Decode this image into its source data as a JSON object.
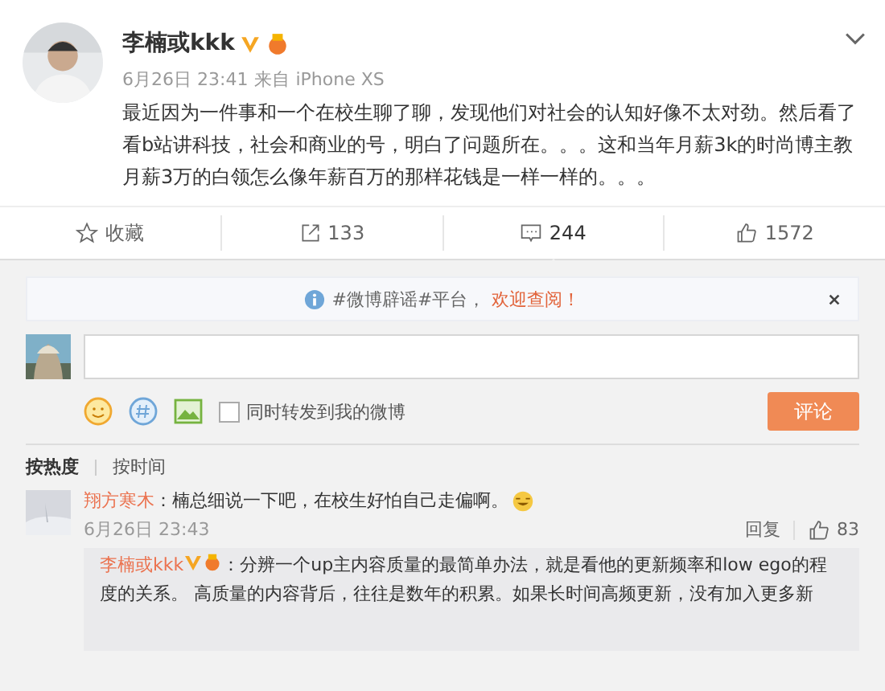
{
  "post": {
    "author": "李楠或kkk",
    "verified": true,
    "time": "6月26日 23:41",
    "source": "来自 iPhone XS",
    "body": "最近因为一件事和一个在校生聊了聊，发现他们对社会的认知好像不太对劲。然后看了看b站讲科技，社会和商业的号，明白了问题所在。。。这和当年月薪3k的时尚博主教月薪3万的白领怎么像年薪百万的那样花钱是一样一样的。。。"
  },
  "actions": [
    {
      "kind": "favorite",
      "label": "收藏",
      "selected": false
    },
    {
      "kind": "repost",
      "label": "133",
      "selected": false
    },
    {
      "kind": "comment",
      "label": "244",
      "selected": true
    },
    {
      "kind": "like",
      "label": "1572",
      "selected": false
    }
  ],
  "notice": {
    "text": "#微博辟谣#平台，",
    "link": "欢迎查阅！"
  },
  "composer": {
    "repost_label": "同时转发到我的微博",
    "repost_checked": false,
    "submit": "评论",
    "submit_disabled": true
  },
  "sort_tabs": [
    {
      "label": "按热度",
      "selected": true
    },
    {
      "label": "按时间",
      "selected": false
    }
  ],
  "comments": [
    {
      "author": "翔方寒木",
      "text": "：楠总细说一下吧，在校生好怕自己走偏啊。",
      "time": "6月26日 23:43",
      "reply": "回复",
      "likes": "83",
      "replies": [
        {
          "author": "李楠或kkk",
          "verified": true,
          "text": "：分辨一个up主内容质量的最简单办法，就是看他的更新频率和low ego的程度的关系。 高质量的内容背后，往往是数年的积累。如果长时间高频更新，没有加入更多新"
        }
      ]
    }
  ]
}
